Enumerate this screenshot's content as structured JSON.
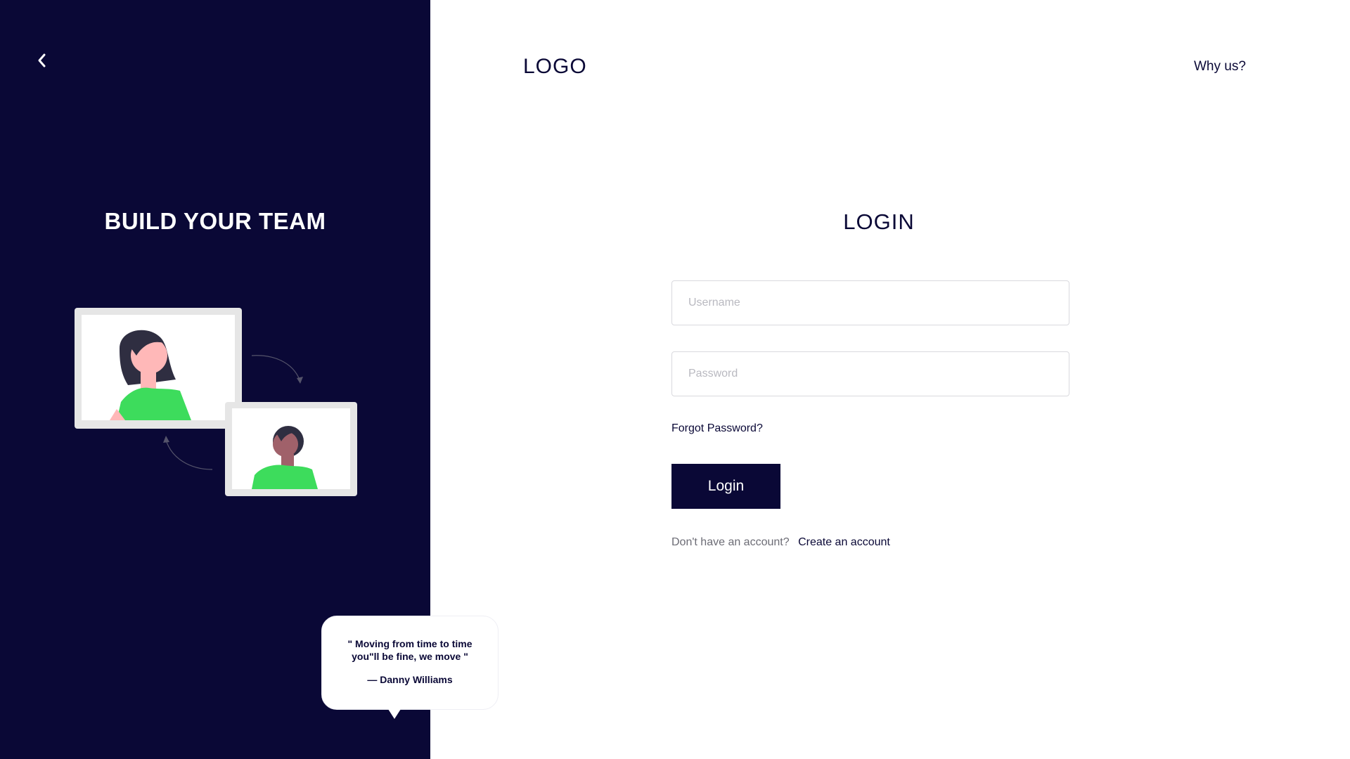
{
  "hero": {
    "title": "BUILD YOUR TEAM",
    "back_icon": "chevron-left-icon"
  },
  "quote": {
    "text": "\" Moving from time to time you\"ll be fine, we move \"",
    "author": "— Danny Williams"
  },
  "header": {
    "logo": "LOGO",
    "why_us": "Why us?"
  },
  "form": {
    "title": "LOGIN",
    "username_placeholder": "Username",
    "password_placeholder": "Password",
    "forgot_label": "Forgot Password?",
    "login_label": "Login",
    "signup_prompt": "Don't have an account?",
    "signup_link": "Create an account"
  },
  "colors": {
    "brand_dark": "#0a0836",
    "accent_green": "#3ddc5c",
    "white": "#ffffff"
  }
}
